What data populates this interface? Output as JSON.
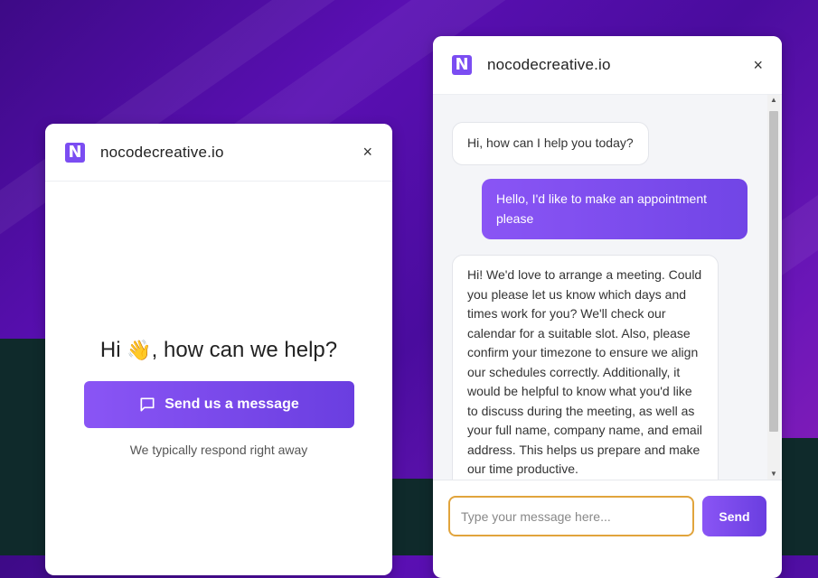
{
  "left_widget": {
    "brand": "nocodecreative.io",
    "logo_letter": "N",
    "close": "×",
    "greeting_pre": "Hi ",
    "greeting_emoji": "👋",
    "greeting_post": ", how can we help?",
    "send_button_label": "Send us a message",
    "response_note": "We typically respond right away"
  },
  "chat_widget": {
    "brand": "nocodecreative.io",
    "logo_letter": "N",
    "close": "×",
    "messages": [
      {
        "from": "bot",
        "text": "Hi, how can I help you today?"
      },
      {
        "from": "user",
        "text": "Hello, I'd like to make an appointment please"
      },
      {
        "from": "bot",
        "text": "Hi! We'd love to arrange a meeting. Could you please let us know which days and times work for you? We'll check our calendar for a suitable slot. Also, please confirm your timezone to ensure we align our schedules correctly. Additionally, it would be helpful to know what you'd like to discuss during the meeting, as well as your full name, company name, and email address. This helps us prepare and make our time productive."
      }
    ],
    "input_placeholder": "Type your message here...",
    "input_value": "",
    "send_label": "Send"
  },
  "colors": {
    "accent": "#7b4df2",
    "input_focus": "#e1a43c"
  }
}
